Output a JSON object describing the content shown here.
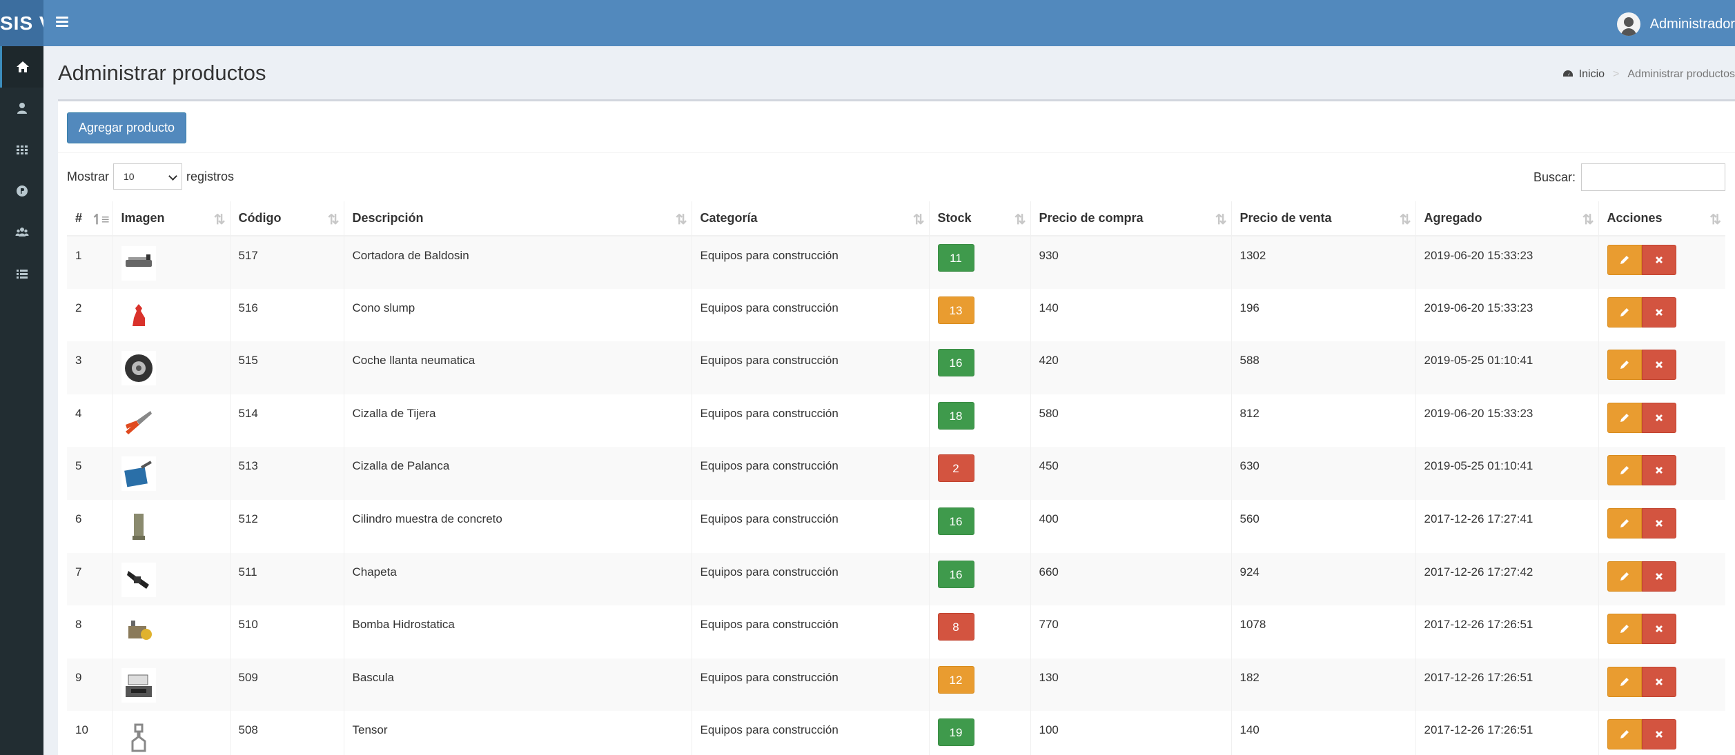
{
  "app": {
    "logo": "SIS V",
    "user_name": "Administrador"
  },
  "sidebar": {
    "items": [
      {
        "icon": "home-icon"
      },
      {
        "icon": "user-icon"
      },
      {
        "icon": "grid-icon"
      },
      {
        "icon": "product-icon"
      },
      {
        "icon": "users-icon"
      },
      {
        "icon": "list-icon"
      }
    ]
  },
  "page": {
    "title": "Administrar productos"
  },
  "breadcrumb": {
    "home": "Inicio",
    "separator": ">",
    "current": "Administrar productos"
  },
  "toolbar": {
    "add_label": "Agregar producto"
  },
  "length_menu": {
    "prefix": "Mostrar",
    "value": "10",
    "suffix": "registros"
  },
  "search": {
    "label": "Buscar:",
    "value": ""
  },
  "table": {
    "columns": [
      "#",
      "Imagen",
      "Código",
      "Descripción",
      "Categoría",
      "Stock",
      "Precio de compra",
      "Precio de venta",
      "Agregado",
      "Acciones"
    ],
    "rows": [
      {
        "n": "1",
        "code": "517",
        "desc": "Cortadora de Baldosin",
        "cat": "Equipos para construcción",
        "stock": "11",
        "stock_status": "green",
        "buy": "930",
        "sell": "1302",
        "added": "2019-06-20 15:33:23"
      },
      {
        "n": "2",
        "code": "516",
        "desc": "Cono slump",
        "cat": "Equipos para construcción",
        "stock": "13",
        "stock_status": "orange",
        "buy": "140",
        "sell": "196",
        "added": "2019-06-20 15:33:23"
      },
      {
        "n": "3",
        "code": "515",
        "desc": "Coche llanta neumatica",
        "cat": "Equipos para construcción",
        "stock": "16",
        "stock_status": "green",
        "buy": "420",
        "sell": "588",
        "added": "2019-05-25 01:10:41"
      },
      {
        "n": "4",
        "code": "514",
        "desc": "Cizalla de Tijera",
        "cat": "Equipos para construcción",
        "stock": "18",
        "stock_status": "green",
        "buy": "580",
        "sell": "812",
        "added": "2019-06-20 15:33:23"
      },
      {
        "n": "5",
        "code": "513",
        "desc": "Cizalla de Palanca",
        "cat": "Equipos para construcción",
        "stock": "2",
        "stock_status": "red",
        "buy": "450",
        "sell": "630",
        "added": "2019-05-25 01:10:41"
      },
      {
        "n": "6",
        "code": "512",
        "desc": "Cilindro muestra de concreto",
        "cat": "Equipos para construcción",
        "stock": "16",
        "stock_status": "green",
        "buy": "400",
        "sell": "560",
        "added": "2017-12-26 17:27:41"
      },
      {
        "n": "7",
        "code": "511",
        "desc": "Chapeta",
        "cat": "Equipos para construcción",
        "stock": "16",
        "stock_status": "green",
        "buy": "660",
        "sell": "924",
        "added": "2017-12-26 17:27:42"
      },
      {
        "n": "8",
        "code": "510",
        "desc": "Bomba Hidrostatica",
        "cat": "Equipos para construcción",
        "stock": "8",
        "stock_status": "red",
        "buy": "770",
        "sell": "1078",
        "added": "2017-12-26 17:26:51"
      },
      {
        "n": "9",
        "code": "509",
        "desc": "Bascula",
        "cat": "Equipos para construcción",
        "stock": "12",
        "stock_status": "orange",
        "buy": "130",
        "sell": "182",
        "added": "2017-12-26 17:26:51"
      },
      {
        "n": "10",
        "code": "508",
        "desc": "Tensor",
        "cat": "Equipos para construcción",
        "stock": "19",
        "stock_status": "green",
        "buy": "100",
        "sell": "140",
        "added": "2017-12-26 17:26:51"
      }
    ]
  },
  "colors": {
    "header": "#5289bd",
    "sidebar": "#222d32",
    "stock_green": "#3f9a4c",
    "stock_orange": "#e99c30",
    "stock_red": "#d35440"
  }
}
